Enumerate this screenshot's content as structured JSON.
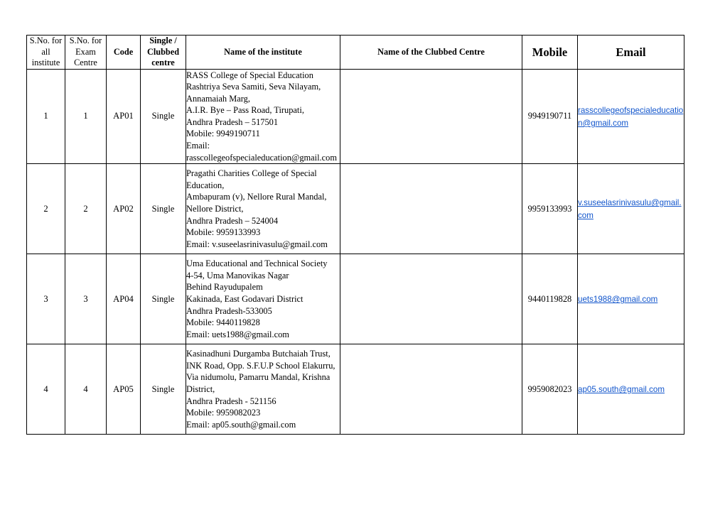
{
  "document": {
    "kind": "table-only-page",
    "background_color": "#ffffff",
    "link_color": "#1155cc",
    "border_color": "#000000"
  },
  "table": {
    "headers": [
      {
        "id": "sno-all",
        "label": "S.No. for\nall\ninstitute",
        "style": "small"
      },
      {
        "id": "sno-exam",
        "label": "S.No. for\nExam\nCentre",
        "style": "small"
      },
      {
        "id": "code",
        "label": "Code",
        "style": "bold"
      },
      {
        "id": "single",
        "label": "Single /\nClubbed\ncentre",
        "style": "bold"
      },
      {
        "id": "institute",
        "label": "Name of the institute",
        "style": "bold"
      },
      {
        "id": "clubbed",
        "label": "Name of the Clubbed Centre",
        "style": "bold"
      },
      {
        "id": "mobile",
        "label": "Mobile",
        "style": "big"
      },
      {
        "id": "email",
        "label": "Email",
        "style": "big"
      }
    ],
    "rows": [
      {
        "sno_all": "1",
        "sno_exam": "1",
        "code": "AP01",
        "single_clubbed": "Single",
        "institute": "RASS College of Special Education\nRashtriya Seva Samiti, Seva Nilayam,\nAnnamaiah Marg,\nA.I.R. Bye – Pass Road, Tirupati,\nAndhra Pradesh – 517501\nMobile: 9949190711\nEmail:\nrasscollegeofspecialeducation@gmail.com",
        "clubbed_centre": "",
        "mobile": "9949190711",
        "email": "rasscollegeofspecialeducation@gmail.com"
      },
      {
        "sno_all": "2",
        "sno_exam": "2",
        "code": "AP02",
        "single_clubbed": "Single",
        "institute": "Pragathi Charities College of Special\nEducation,\nAmbapuram (v), Nellore Rural Mandal,\nNellore District,\nAndhra Pradesh – 524004\nMobile: 9959133993\nEmail: v.suseelasrinivasulu@gmail.com",
        "clubbed_centre": "",
        "mobile": "9959133993",
        "email": "v.suseelasrinivasulu@gmail.com"
      },
      {
        "sno_all": "3",
        "sno_exam": "3",
        "code": "AP04",
        "single_clubbed": "Single",
        "institute": "Uma Educational and Technical Society\n4-54, Uma Manovikas Nagar\nBehind Rayudupalem\nKakinada, East Godavari District\nAndhra Pradesh-533005\nMobile: 9440119828\nEmail: uets1988@gmail.com",
        "clubbed_centre": "",
        "mobile": "9440119828",
        "email": "uets1988@gmail.com "
      },
      {
        "sno_all": "4",
        "sno_exam": "4",
        "code": "AP05",
        "single_clubbed": "Single",
        "institute": "Kasinadhuni Durgamba Butchaiah Trust,\nINK Road, Opp. S.F.U.P School Elakurru,\nVia nidumolu, Pamarru Mandal, Krishna\nDistrict,\nAndhra Pradesh - 521156\nMobile: 9959082023\nEmail: ap05.south@gmail.com",
        "clubbed_centre": "",
        "mobile": "9959082023",
        "email": "ap05.south@gmail.com"
      }
    ]
  }
}
